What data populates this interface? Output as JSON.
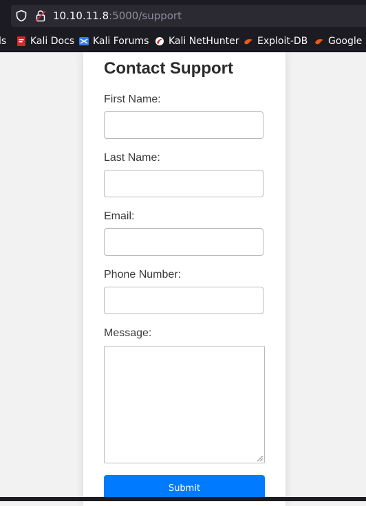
{
  "browser": {
    "url_host": "10.10.11.8",
    "url_rest": ":5000/support",
    "bookmarks": [
      {
        "label": "ls",
        "icon": "partial-bookmark-icon"
      },
      {
        "label": "Kali Docs",
        "icon": "kali-docs-icon"
      },
      {
        "label": "Kali Forums",
        "icon": "kali-forums-icon"
      },
      {
        "label": "Kali NetHunter",
        "icon": "kali-nethunter-icon"
      },
      {
        "label": "Exploit-DB",
        "icon": "exploit-db-icon"
      },
      {
        "label": "Google H",
        "icon": "google-hacking-icon"
      }
    ]
  },
  "form": {
    "title": "Contact Support",
    "first_name_label": "First Name:",
    "last_name_label": "Last Name:",
    "email_label": "Email:",
    "phone_label": "Phone Number:",
    "message_label": "Message:",
    "submit_label": "Submit"
  },
  "colors": {
    "submit": "#007bff",
    "chrome": "#1c1b22"
  }
}
